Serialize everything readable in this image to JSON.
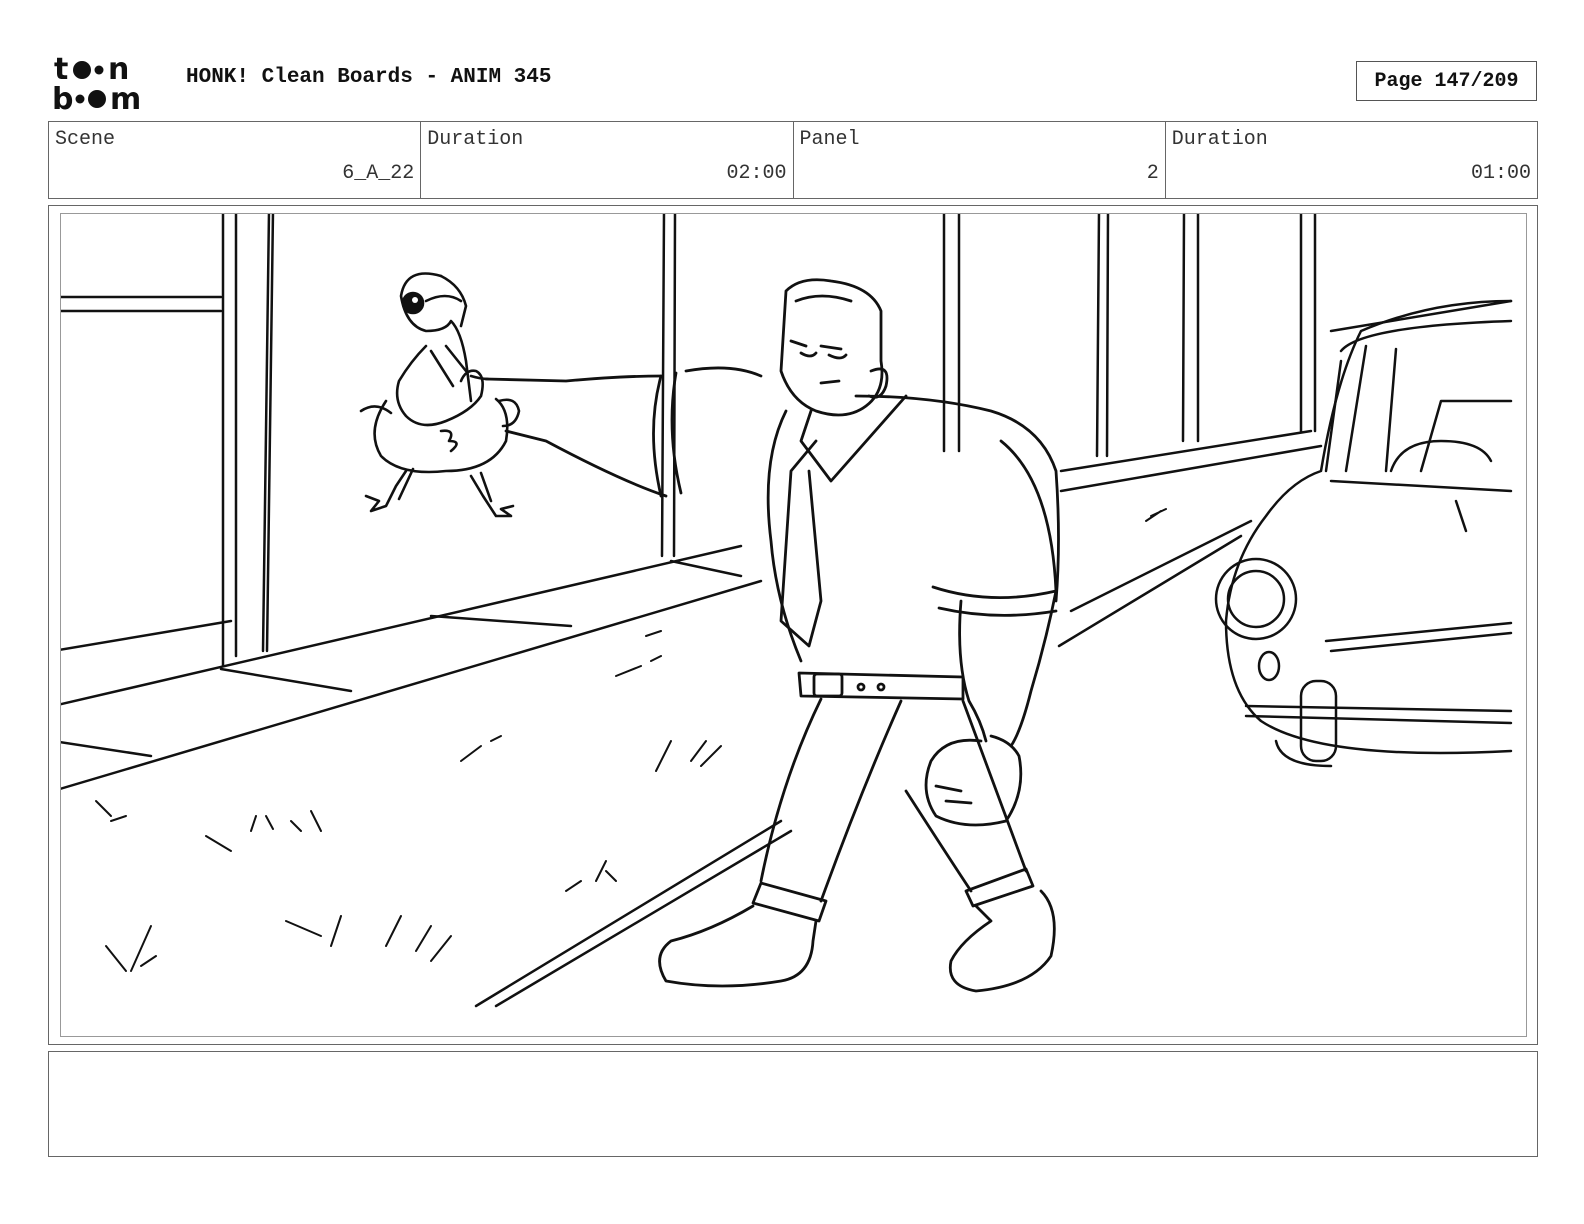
{
  "header": {
    "logo_text": "toon boom",
    "title": "HONK! Clean Boards - ANIM 345",
    "page_label": "Page 147/209"
  },
  "info": {
    "scene_label": "Scene",
    "scene_value": "6_A_22",
    "scene_duration_label": "Duration",
    "scene_duration_value": "02:00",
    "panel_label": "Panel",
    "panel_value": "2",
    "panel_duration_label": "Duration",
    "panel_duration_value": "01:00"
  },
  "panel": {
    "drawing": "man-holding-goose-street-sketch"
  },
  "notes": {
    "text": ""
  }
}
